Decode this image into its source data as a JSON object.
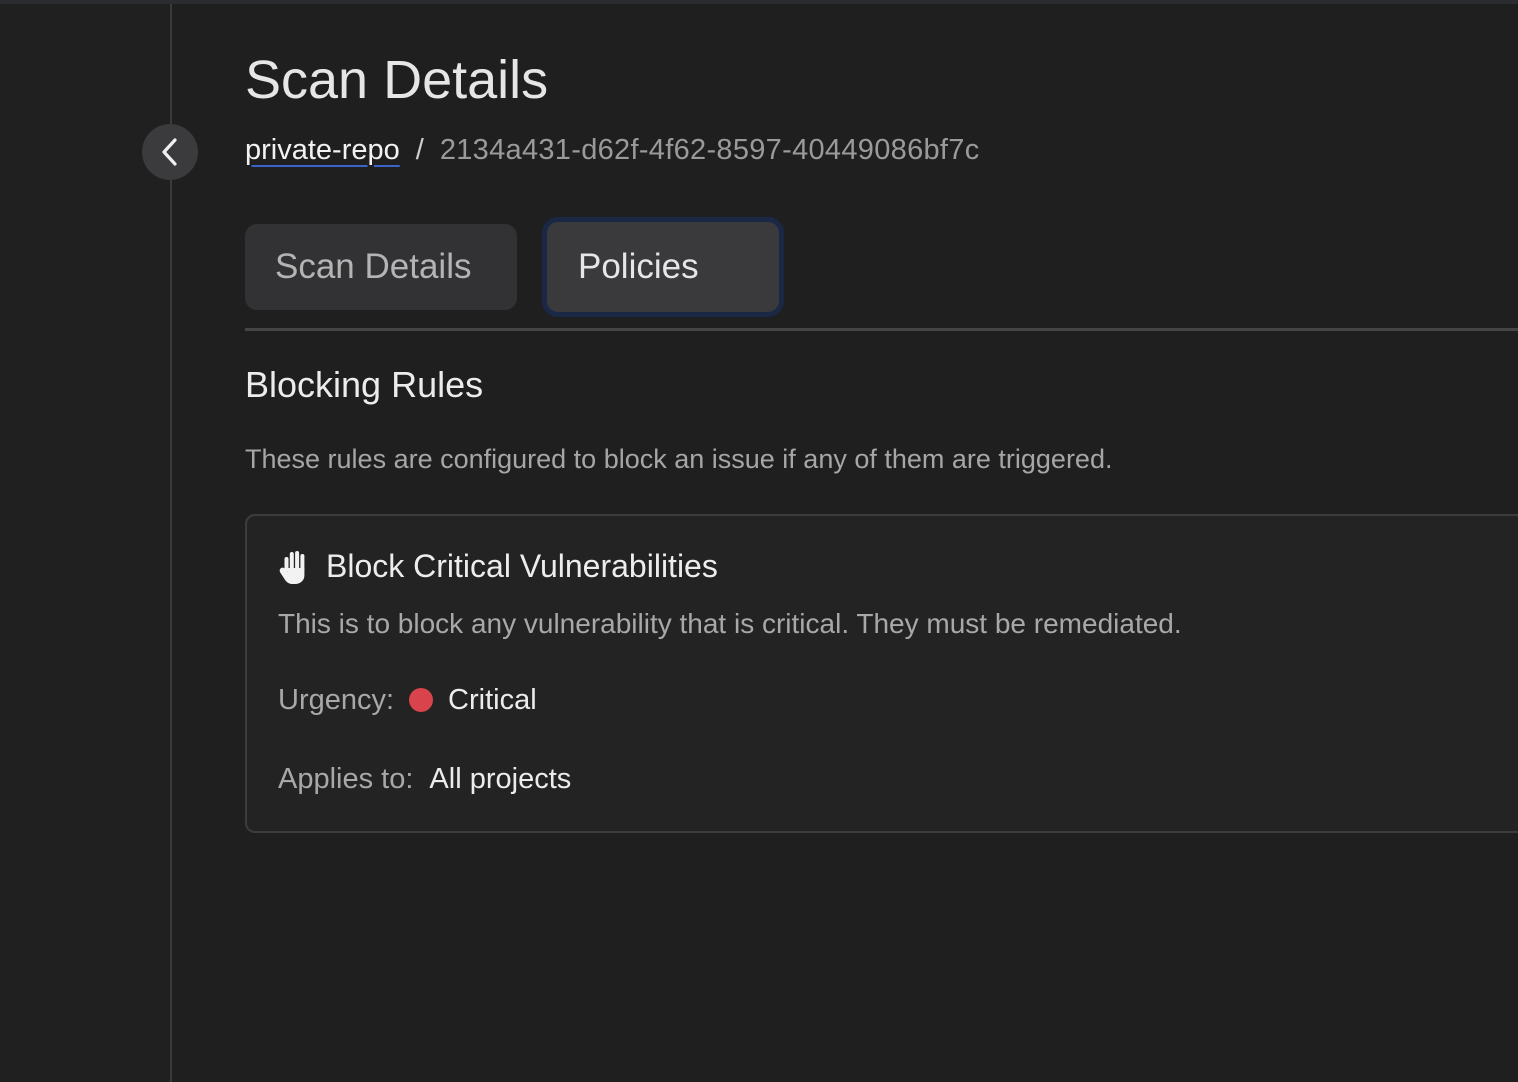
{
  "header": {
    "title": "Scan Details",
    "breadcrumb": {
      "repo": "private-repo",
      "separator": "/",
      "scan_id": "2134a431-d62f-4f62-8597-40449086bf7c"
    }
  },
  "tabs": [
    {
      "label": "Scan Details",
      "active": false
    },
    {
      "label": "Policies",
      "active": true
    }
  ],
  "section": {
    "title": "Blocking Rules",
    "description": "These rules are configured to block an issue if any of them are triggered."
  },
  "rules": [
    {
      "icon": "hand-stop-icon",
      "title": "Block Critical Vulnerabilities",
      "description": "This is to block any vulnerability that is critical. They must be remediated.",
      "urgency_label": "Urgency:",
      "urgency_value": "Critical",
      "urgency_color": "#d9434b",
      "applies_label": "Applies to:",
      "applies_value": "All projects"
    }
  ],
  "colors": {
    "background": "#1f1f1f",
    "card_border": "#3c3c3c",
    "active_tab_ring": "#1a2846",
    "link_underline": "#3b63c9"
  }
}
